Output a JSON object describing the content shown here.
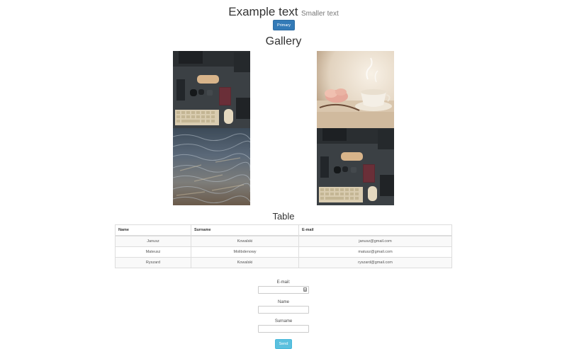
{
  "header": {
    "title": "Example text",
    "subtitle": "Smaller text",
    "primary_button": "Primary"
  },
  "gallery": {
    "title": "Gallery",
    "images": [
      {
        "name": "desk-flatlay-keyboard"
      },
      {
        "name": "ocean-waves-texture"
      },
      {
        "name": "tea-cup-flowers"
      },
      {
        "name": "desk-flatlay-keyboard-2"
      }
    ]
  },
  "table_section": {
    "title": "Table",
    "columns": [
      "Name",
      "Surname",
      "E-mail"
    ],
    "rows": [
      [
        "Janusz",
        "Kowalski",
        "janusz@gmail.com"
      ],
      [
        "Mateusz",
        "Molibdenowy",
        "matusz@gmail.com"
      ],
      [
        "Ryszard",
        "Kowalski",
        "ryszard@gmail.com"
      ]
    ]
  },
  "form": {
    "email_label": "E-mail:",
    "email_value": "",
    "name_label": "Name",
    "name_value": "",
    "surname_label": "Surname",
    "surname_value": "",
    "send_button": "Send"
  },
  "colors": {
    "primary": "#337ab7",
    "info": "#5bc0de"
  }
}
